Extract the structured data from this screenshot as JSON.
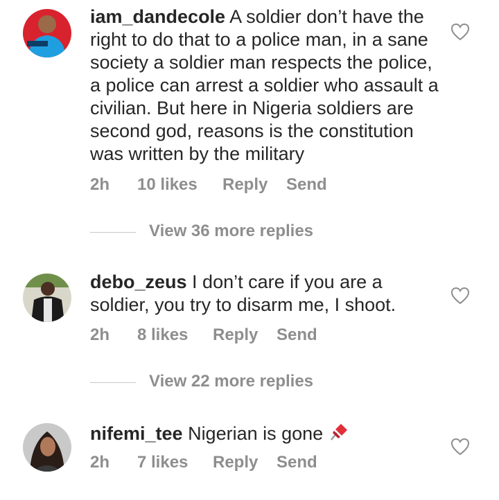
{
  "comments": [
    {
      "username": "iam_dandecole",
      "text": " A soldier don’t have the right to do that to a police man, in a sane society a soldier man respects the police, a police can arrest a soldier who assault a civilian. But here in Nigeria soldiers are second god, reasons is the constitution was written by the military",
      "time": "2h",
      "likes": "10 likes",
      "reply": "Reply",
      "send": "Send",
      "view_more": "View 36 more replies"
    },
    {
      "username": "debo_zeus",
      "text": " I don’t care if you are a soldier, you try to disarm me, I shoot.",
      "time": "2h",
      "likes": "8 likes",
      "reply": "Reply",
      "send": "Send",
      "view_more": "View 22 more replies"
    },
    {
      "username": "nifemi_tee",
      "text": " Nigerian is gone ",
      "time": "2h",
      "likes": "7 likes",
      "reply": "Reply",
      "send": "Send"
    }
  ],
  "colors": {
    "text": "#262626",
    "meta": "#8e8e8e",
    "pin": "#e0303a"
  },
  "icons": {
    "like": "heart-outline-icon",
    "pin": "pushpin-emoji"
  }
}
